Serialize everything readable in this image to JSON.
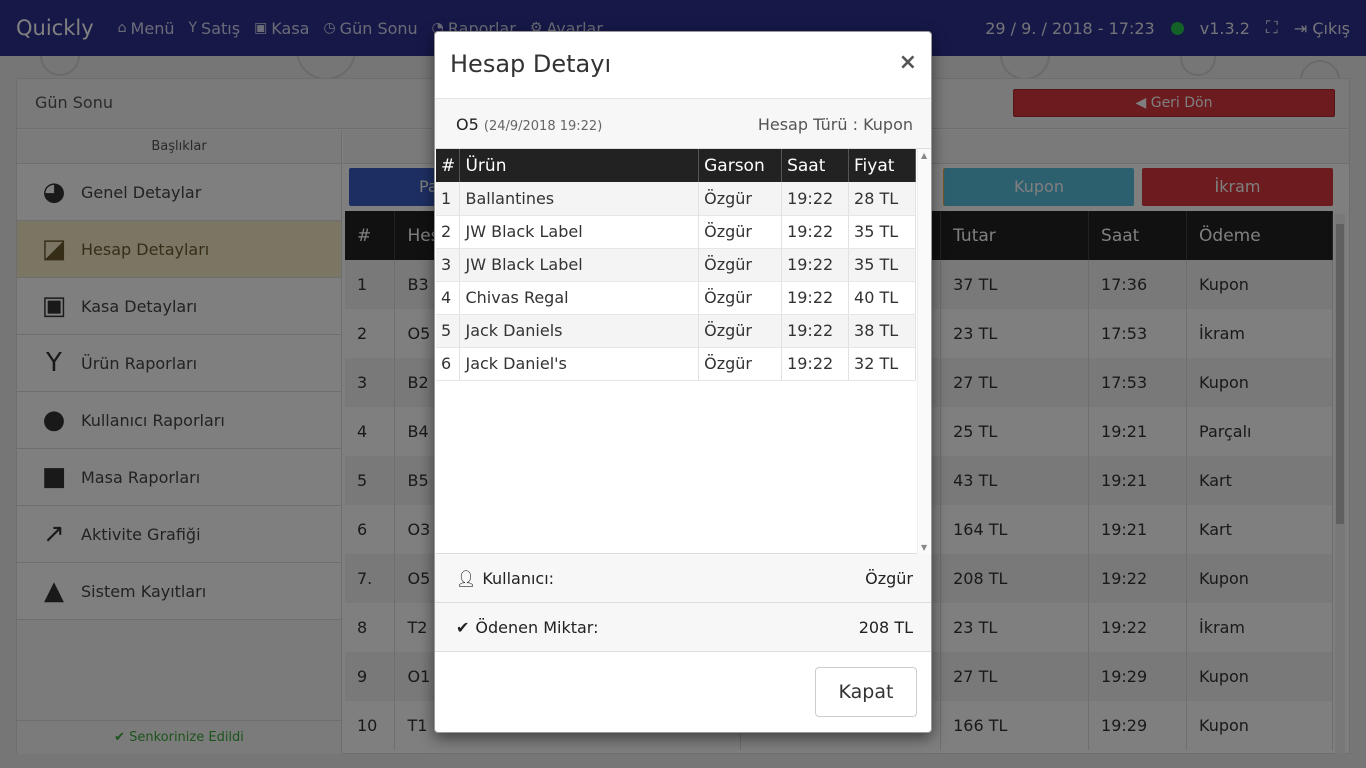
{
  "topbar": {
    "brand": "Quickly",
    "nav": [
      {
        "icon": "home-icon",
        "glyph": "⌂",
        "label": "Menü"
      },
      {
        "icon": "glass-icon",
        "glyph": "Y",
        "label": "Satış"
      },
      {
        "icon": "money-icon",
        "glyph": "▣",
        "label": "Kasa"
      },
      {
        "icon": "clock-icon",
        "glyph": "◷",
        "label": "Gün Sonu"
      },
      {
        "icon": "pie-icon",
        "glyph": "◔",
        "label": "Raporlar"
      },
      {
        "icon": "gears-icon",
        "glyph": "⚙",
        "label": "Ayarlar"
      }
    ],
    "datetime": "29 / 9. / 2018 - 17:23",
    "version": "v1.3.2",
    "logout": "Çıkış"
  },
  "page": {
    "title": "Gün Sonu",
    "back_button": "◀ Geri Dön"
  },
  "leftmenu": {
    "heading": "Başlıklar",
    "items": [
      {
        "label": "Genel Detaylar",
        "icon": "pie-chart-icon",
        "glyph": "◕"
      },
      {
        "label": "Hesap Detayları",
        "icon": "sticky-note-icon",
        "glyph": "◪"
      },
      {
        "label": "Kasa Detayları",
        "icon": "money-icon",
        "glyph": "▣"
      },
      {
        "label": "Ürün Raporları",
        "icon": "cocktail-icon",
        "glyph": "Y"
      },
      {
        "label": "Kullanıcı Raporları",
        "icon": "user-icon",
        "glyph": "●"
      },
      {
        "label": "Masa Raporları",
        "icon": "stop-icon",
        "glyph": "■"
      },
      {
        "label": "Aktivite Grafiği",
        "icon": "line-chart-icon",
        "glyph": "↗"
      },
      {
        "label": "Sistem Kayıtları",
        "icon": "bell-icon",
        "glyph": "▲"
      }
    ],
    "sync": "✔ Senkorinize Edildi"
  },
  "filters": {
    "left_visible": "Pa",
    "kupon": "Kupon",
    "ikram": "İkram"
  },
  "bgtable": {
    "headers": [
      "#",
      "Hes",
      "Tutar",
      "Saat",
      "Ödeme"
    ],
    "rows": [
      [
        "1",
        "B3",
        "37 TL",
        "17:36",
        "Kupon"
      ],
      [
        "2",
        "O5",
        "23 TL",
        "17:53",
        "İkram"
      ],
      [
        "3",
        "B2",
        "27 TL",
        "17:53",
        "Kupon"
      ],
      [
        "4",
        "B4",
        "25 TL",
        "19:21",
        "Parçalı"
      ],
      [
        "5",
        "B5",
        "43 TL",
        "19:21",
        "Kart"
      ],
      [
        "6",
        "O3",
        "164 TL",
        "19:21",
        "Kart"
      ],
      [
        "7.",
        "O5",
        "208 TL",
        "19:22",
        "Kupon"
      ],
      [
        "8",
        "T2",
        "23 TL",
        "19:22",
        "İkram"
      ],
      [
        "9",
        "O1",
        "27 TL",
        "19:29",
        "Kupon"
      ],
      [
        "10",
        "T1",
        "166 TL",
        "19:29",
        "Kupon"
      ]
    ]
  },
  "modal": {
    "title": "Hesap Detayı",
    "close_x": "×",
    "account_code": "O5",
    "account_date": "(24/9/2018 19:22)",
    "account_type": "Hesap Türü : Kupon",
    "table": {
      "headers": [
        "#",
        "Ürün",
        "Garson",
        "Saat",
        "Fiyat"
      ],
      "rows": [
        [
          "1",
          "Ballantines",
          "Özgür",
          "19:22",
          "28 TL"
        ],
        [
          "2",
          "JW Black Label",
          "Özgür",
          "19:22",
          "35 TL"
        ],
        [
          "3",
          "JW Black Label",
          "Özgür",
          "19:22",
          "35 TL"
        ],
        [
          "4",
          "Chivas Regal",
          "Özgür",
          "19:22",
          "40 TL"
        ],
        [
          "5",
          "Jack Daniels",
          "Özgür",
          "19:22",
          "38 TL"
        ],
        [
          "6",
          "Jack Daniel's",
          "Özgür",
          "19:22",
          "32 TL"
        ]
      ]
    },
    "user_label": "Kullanıcı:",
    "user_value": "Özgür",
    "paid_label": "Ödenen Miktar:",
    "paid_value": "208 TL",
    "close_button": "Kapat"
  }
}
